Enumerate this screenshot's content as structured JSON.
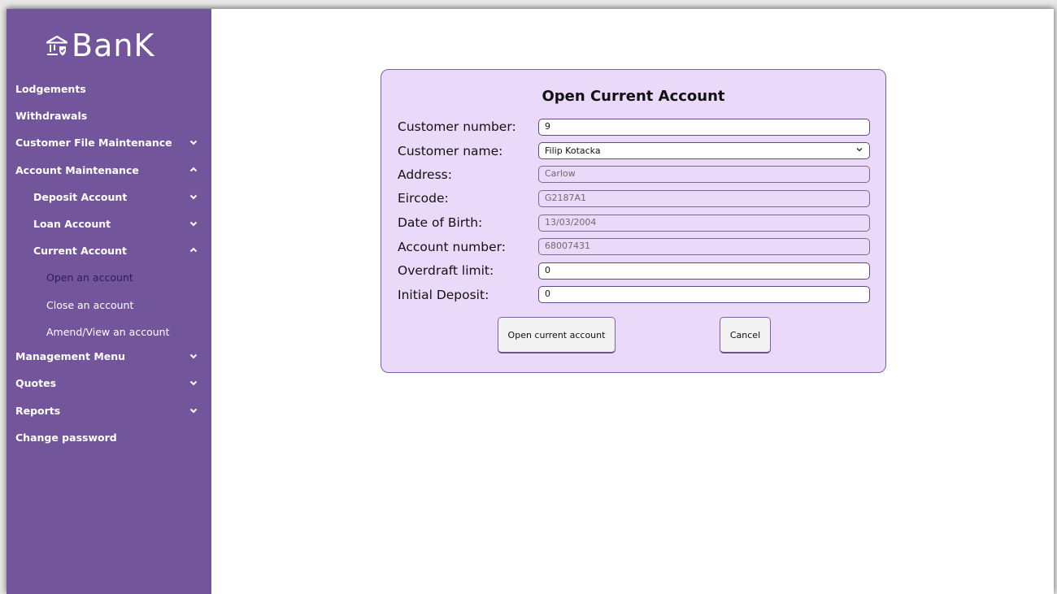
{
  "app": {
    "logo_text": "BanK",
    "brand_color": "#72559b"
  },
  "sidebar": {
    "items": [
      {
        "label": "Lodgements",
        "icon": ""
      },
      {
        "label": "Withdrawals",
        "icon": ""
      },
      {
        "label": "Customer File Maintenance",
        "icon": "chevron-down-icon"
      },
      {
        "label": "Account Maintenance",
        "icon": "chevron-up-icon"
      },
      {
        "label": "Deposit Account",
        "icon": "chevron-down-icon"
      },
      {
        "label": "Loan Account",
        "icon": "chevron-down-icon"
      },
      {
        "label": "Current Account",
        "icon": "chevron-up-icon"
      },
      {
        "label": "Open an account",
        "active": true
      },
      {
        "label": "Close an account"
      },
      {
        "label": "Amend/View an account"
      },
      {
        "label": "Management Menu",
        "icon": "chevron-down-icon"
      },
      {
        "label": "Quotes",
        "icon": "chevron-down-icon"
      },
      {
        "label": "Reports",
        "icon": "chevron-down-icon"
      },
      {
        "label": "Change password",
        "icon": ""
      }
    ]
  },
  "form": {
    "title": "Open Current Account",
    "fields": [
      {
        "label": "Customer number:",
        "value": "9"
      },
      {
        "label": "Customer name:",
        "value": "Filip Kotacka"
      },
      {
        "label": "Address:",
        "value": "Carlow"
      },
      {
        "label": "Eircode:",
        "value": "G2187A1"
      },
      {
        "label": "Date of Birth:",
        "value": "13/03/2004"
      },
      {
        "label": "Account number:",
        "value": "68007431"
      },
      {
        "label": "Overdraft limit:",
        "value": "0"
      },
      {
        "label": "Initial Deposit:",
        "value": "0"
      }
    ],
    "submit_label": "Open current account",
    "cancel_label": "Cancel"
  }
}
